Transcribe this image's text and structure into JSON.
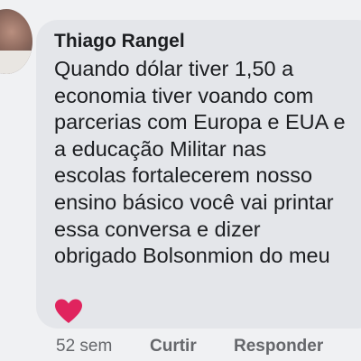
{
  "comment": {
    "author": "Thiago Rangel",
    "text_lines": [
      "Quando dólar tiver 1,50 a",
      "economia tiver voando com",
      "parcerias com Europa e EUA e",
      "a educação Militar nas",
      "escolas fortalecerem nosso",
      "ensino básico você vai printar",
      "essa conversa e dizer",
      "obrigado Bolsonmion do meu"
    ],
    "reaction_icon": "heart-icon",
    "reaction_color": "#e0245e"
  },
  "actions": {
    "timestamp": "52 sem",
    "like_label": "Curtir",
    "reply_label": "Responder"
  },
  "colors": {
    "background": "#f0f1f3",
    "bubble": "#e4e6ea",
    "text": "#1c1e21",
    "secondary_text": "#65676b"
  }
}
